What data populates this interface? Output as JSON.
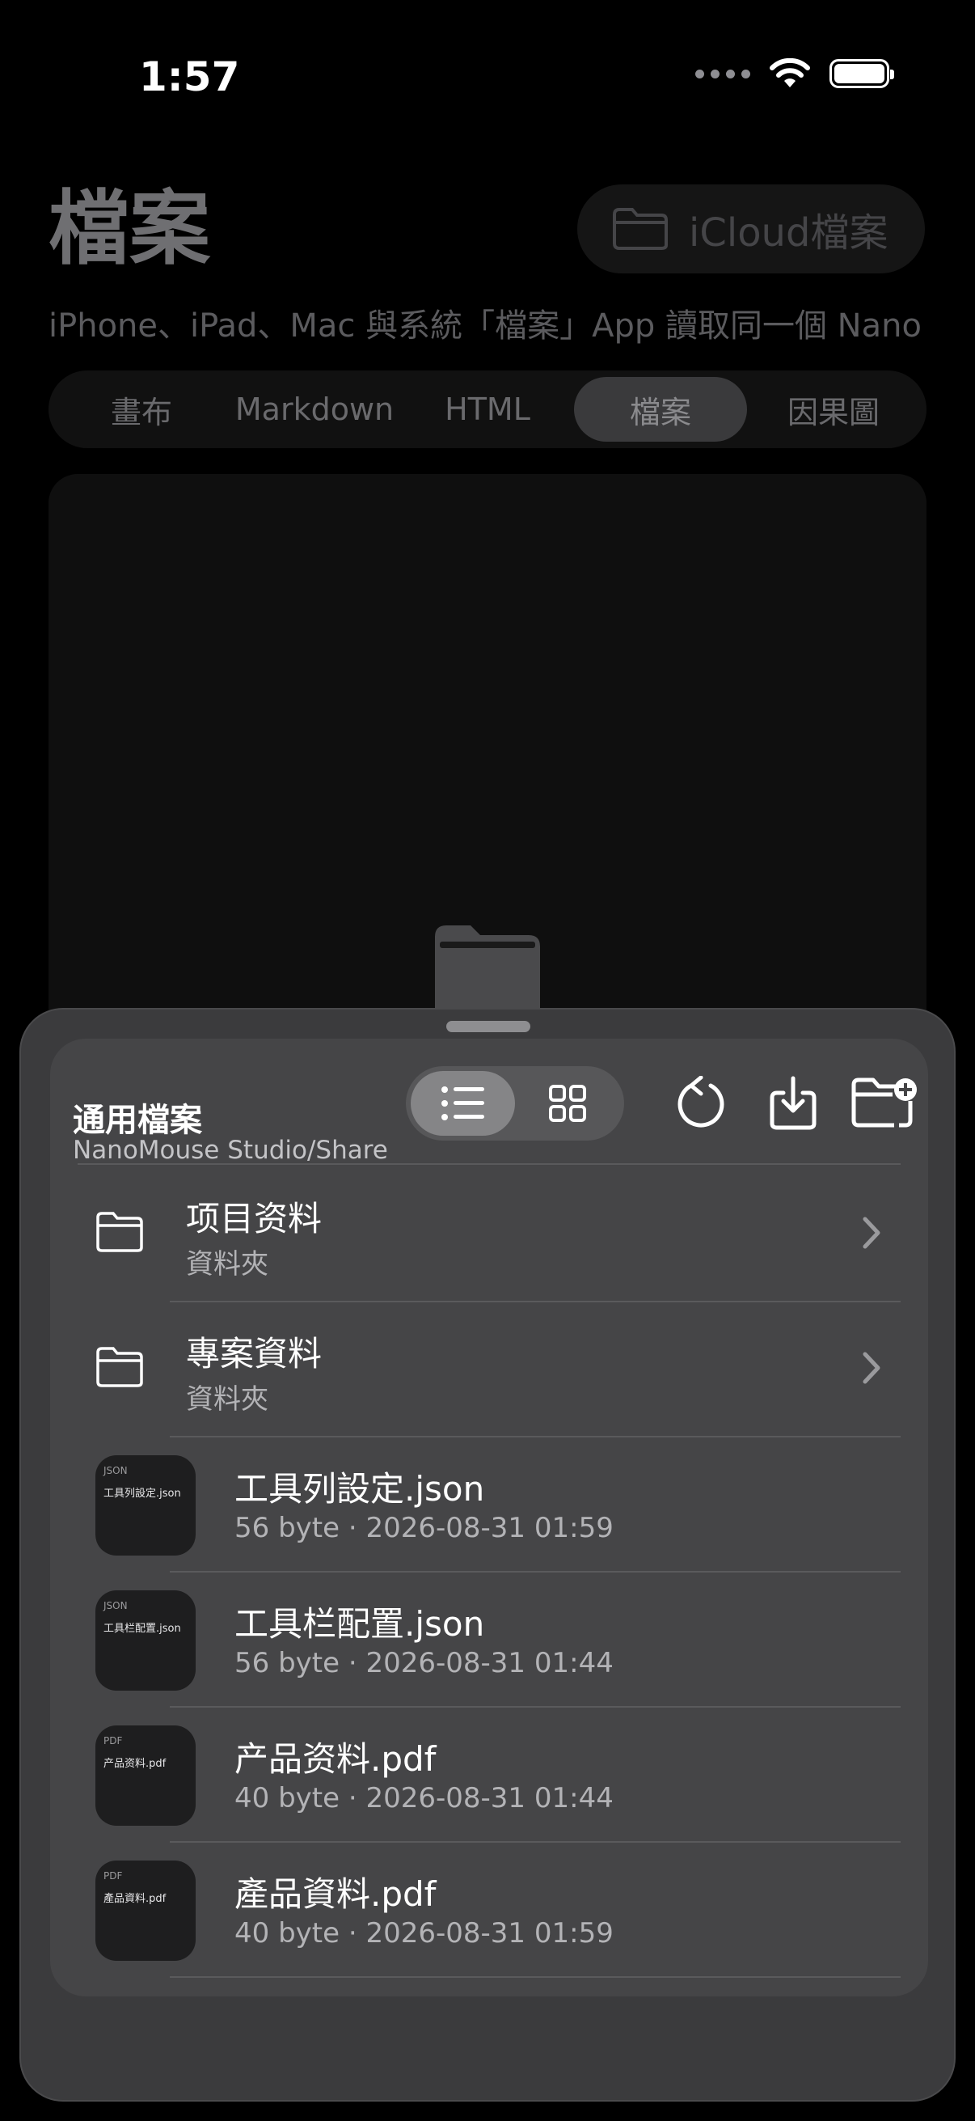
{
  "status_bar": {
    "time": "1:57"
  },
  "page": {
    "title": "檔案",
    "icloud_button": "iCloud檔案",
    "subtitle": "iPhone、iPad、Mac 與系統「檔案」App 讀取同一個 Nano",
    "tabs": [
      "畫布",
      "Markdown",
      "HTML",
      "檔案",
      "因果圖"
    ],
    "active_tab": "檔案"
  },
  "sheet": {
    "title": "通用檔案",
    "path": "NanoMouse Studio/Share",
    "view_mode": "list",
    "items": [
      {
        "type": "folder",
        "name": "项目资料",
        "detail": "資料夾"
      },
      {
        "type": "folder",
        "name": "專案資料",
        "detail": "資料夾"
      },
      {
        "type": "file",
        "kind": "JSON",
        "name": "工具列設定.json",
        "detail": "56 byte · 2026-08-31 01:59"
      },
      {
        "type": "file",
        "kind": "JSON",
        "name": "工具栏配置.json",
        "detail": "56 byte · 2026-08-31 01:44"
      },
      {
        "type": "file",
        "kind": "PDF",
        "name": "产品资料.pdf",
        "detail": "40 byte · 2026-08-31 01:44"
      },
      {
        "type": "file",
        "kind": "PDF",
        "name": "產品資料.pdf",
        "detail": "40 byte · 2026-08-31 01:59"
      }
    ]
  },
  "icons": {
    "status": [
      "cellular-dots-icon",
      "wifi-icon",
      "battery-icon"
    ],
    "header": [
      "list-view-icon",
      "grid-view-icon",
      "refresh-icon",
      "import-icon",
      "new-folder-icon"
    ],
    "rows": [
      "folder-icon",
      "chevron-right-icon",
      "file-thumbnail"
    ]
  },
  "colors": {
    "background": "#000000",
    "sheet": "#3b3b3d",
    "card": "#454547",
    "accent": "#858587"
  }
}
